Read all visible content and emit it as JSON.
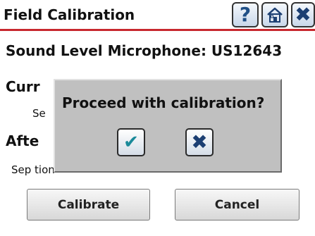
{
  "window": {
    "title": "Field Calibration",
    "accent_color": "#c8282e",
    "icons": {
      "help": "question-mark",
      "home": "house",
      "close": "x-mark"
    },
    "help_glyph": "?",
    "close_glyph": "✖"
  },
  "content": {
    "device_line": "Sound Level Microphone:  US12643",
    "current_label": "Curr",
    "current_sub": "Se",
    "after_label": "Afte",
    "after_sub": "Sep                                              tion"
  },
  "buttons": {
    "calibrate": "Calibrate",
    "cancel": "Cancel"
  },
  "dialog": {
    "message": "Proceed with calibration?",
    "confirm_glyph": "✔",
    "reject_glyph": "✖"
  }
}
